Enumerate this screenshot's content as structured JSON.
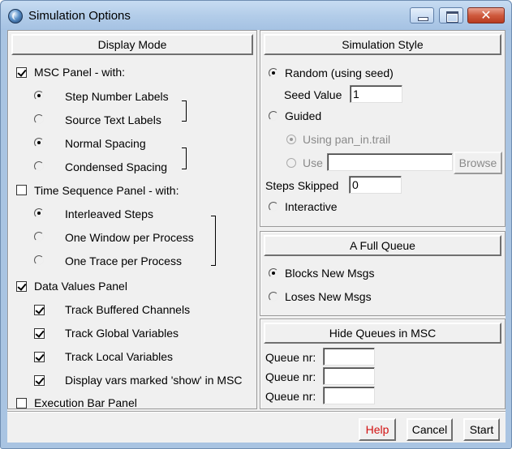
{
  "window": {
    "title": "Simulation Options",
    "close_glyph": "✕"
  },
  "display_mode": {
    "heading": "Display Mode",
    "msc_panel": "MSC Panel - with:",
    "step_number_labels": "Step Number Labels",
    "source_text_labels": "Source Text Labels",
    "normal_spacing": "Normal Spacing",
    "condensed_spacing": "Condensed Spacing",
    "time_sequence_panel": "Time Sequence Panel - with:",
    "interleaved_steps": "Interleaved Steps",
    "one_window_per_process": "One Window per Process",
    "one_trace_per_process": "One Trace per Process",
    "data_values_panel": "Data Values Panel",
    "track_buffered_channels": "Track Buffered Channels",
    "track_global_variables": "Track Global Variables",
    "track_local_variables": "Track Local Variables",
    "display_vars_show": "Display vars marked 'show' in MSC",
    "execution_bar_panel": "Execution Bar Panel"
  },
  "simulation_style": {
    "heading": "Simulation Style",
    "random": "Random (using seed)",
    "seed_label": "Seed Value",
    "seed_value": "1",
    "guided": "Guided",
    "using_trail": "Using pan_in.trail",
    "use": "Use",
    "use_value": "",
    "browse": "Browse",
    "steps_skipped_label": "Steps Skipped",
    "steps_skipped_value": "0",
    "interactive": "Interactive"
  },
  "full_queue": {
    "heading": "A Full Queue",
    "blocks": "Blocks New Msgs",
    "loses": "Loses New Msgs"
  },
  "hide_queues": {
    "heading": "Hide Queues in MSC",
    "queue_label_1": "Queue nr:",
    "queue_label_2": "Queue nr:",
    "queue_label_3": "Queue nr:"
  },
  "footer": {
    "help": "Help",
    "cancel": "Cancel",
    "start": "Start"
  }
}
